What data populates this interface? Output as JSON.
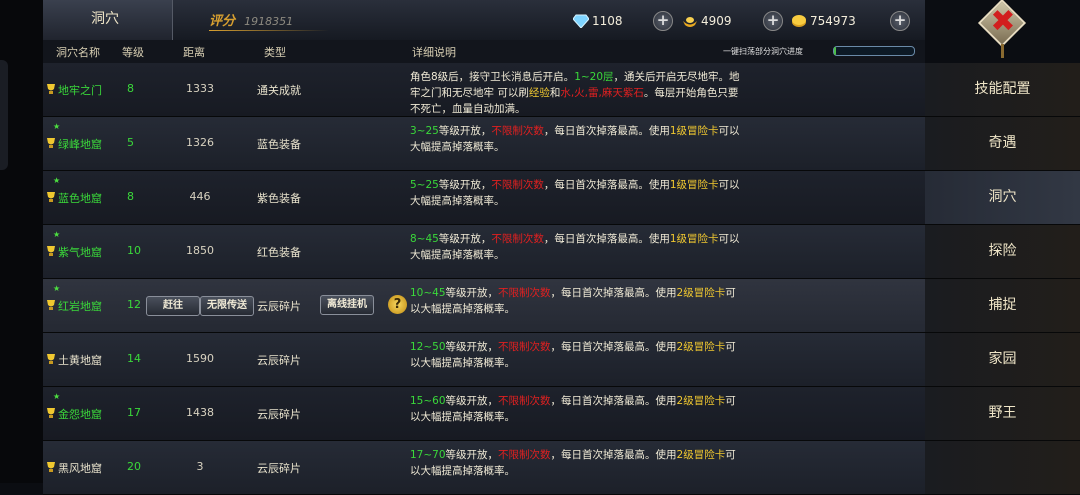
{
  "window": {
    "title": "洞穴"
  },
  "score": {
    "label": "评分",
    "value": "1918351"
  },
  "resources": [
    {
      "icon": "diamond-icon",
      "value": "1108"
    },
    {
      "icon": "gold-ingot-icon",
      "value": "4909"
    },
    {
      "icon": "coin-icon",
      "value": "754973"
    }
  ],
  "close": {
    "glyph": "✖"
  },
  "columns": {
    "name": "洞穴名称",
    "level": "等级",
    "distance": "距离",
    "type": "类型",
    "detail": "详细说明"
  },
  "scan": {
    "label": "一键扫荡部分洞穴进度",
    "progress_fraction": 0.03
  },
  "caves": [
    {
      "name": "地牢之门",
      "level": "8",
      "distance": "1333",
      "type": "通关成就",
      "star": false,
      "green": true,
      "desc": [
        "角色8级后，接守卫长消息后开启。",
        "1~20层",
        "，通关后开启",
        "无尽地牢。地牢之门和无尽地牢 可以刷",
        "经验",
        "和",
        "水,火,雷,麻",
        "天紫石",
        "。每层开始角色只要不死亡，血量自动加满。"
      ]
    },
    {
      "name": "绿峰地窟",
      "level": "5",
      "distance": "1326",
      "type": "蓝色装备",
      "star": true,
      "green": true,
      "range": "3~25",
      "tail": "1级冒险卡"
    },
    {
      "name": "蓝色地窟",
      "level": "8",
      "distance": "446",
      "type": "紫色装备",
      "star": true,
      "green": true,
      "range": "5~25",
      "tail": "1级冒险卡"
    },
    {
      "name": "紫气地窟",
      "level": "10",
      "distance": "1850",
      "type": "红色装备",
      "star": true,
      "green": true,
      "range": "8~45",
      "tail": "1级冒险卡"
    },
    {
      "name": "红岩地窟",
      "level": "12",
      "distance": "",
      "type": "云辰碎片",
      "star": true,
      "green": true,
      "range": "10~45",
      "tail": "2级冒险卡"
    },
    {
      "name": "土黄地窟",
      "level": "14",
      "distance": "1590",
      "type": "云辰碎片",
      "star": false,
      "green": false,
      "range": "12~50",
      "tail": "2级冒险卡"
    },
    {
      "name": "金怨地窟",
      "level": "17",
      "distance": "1438",
      "type": "云辰碎片",
      "star": true,
      "green": true,
      "range": "15~60",
      "tail": "2级冒险卡"
    },
    {
      "name": "黑风地窟",
      "level": "20",
      "distance": "3",
      "type": "云辰碎片",
      "star": false,
      "green": false,
      "range": "17~70",
      "tail": "2级冒险卡"
    }
  ],
  "desc_common": {
    "open": "等级开放，",
    "unlimited": "不限制次数",
    "daily": "，每日首次掉落最高。使用",
    "boost": "可以大幅提高掉落概率。"
  },
  "row_buttons": {
    "goto": "赶往",
    "teleport": "无限传送",
    "afk": "离线挂机",
    "help": "?"
  },
  "sidebar": [
    {
      "label": "技能配置",
      "active": false
    },
    {
      "label": "奇遇",
      "active": false
    },
    {
      "label": "洞穴",
      "active": true
    },
    {
      "label": "探险",
      "active": false
    },
    {
      "label": "捕捉",
      "active": false
    },
    {
      "label": "家园",
      "active": false
    },
    {
      "label": "野王",
      "active": false
    },
    {
      "label": "",
      "active": false
    }
  ]
}
